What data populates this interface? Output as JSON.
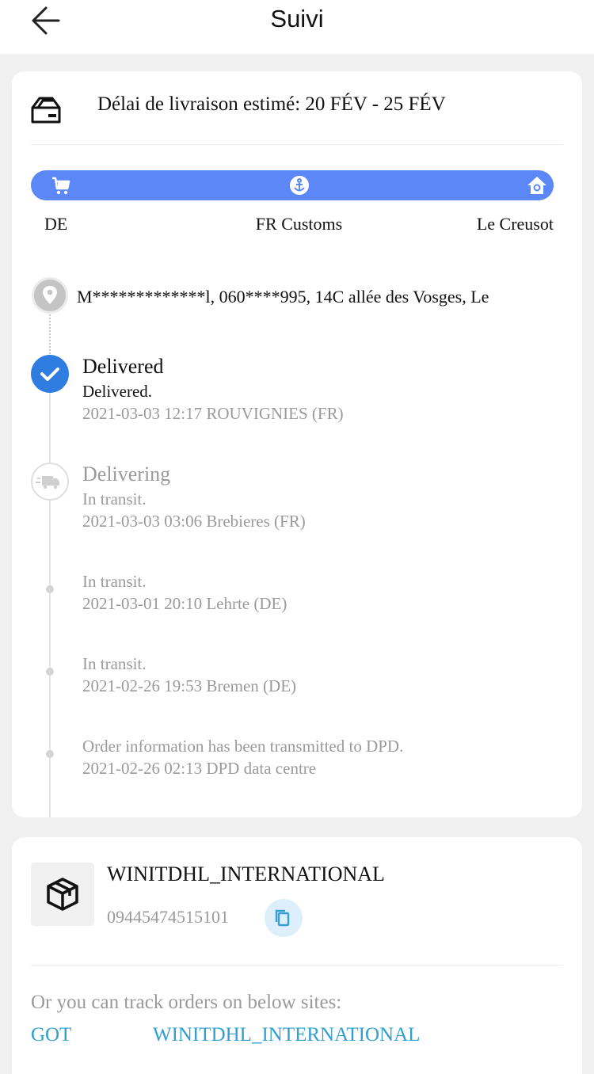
{
  "header": {
    "title": "Suivi"
  },
  "estimate": {
    "text": "Délai de livraison estimé: 20 FÉV - 25 FÉV"
  },
  "route": {
    "color": "#5b87f7",
    "stops": [
      {
        "label": "DE",
        "icon": "cart-icon"
      },
      {
        "label": "FR Customs",
        "icon": "anchor-icon"
      },
      {
        "label": "Le Creusot",
        "icon": "home-icon"
      }
    ]
  },
  "address": {
    "text": "M*************l,  060****995,  14C allée des Vosges,  Le"
  },
  "events": [
    {
      "title": "Delivered",
      "detail": "Delivered.",
      "time_place": "2021-03-03 12:17 ROUVIGNIES (FR)"
    },
    {
      "title": "Delivering",
      "detail": "In transit.",
      "time_place": "2021-03-03 03:06 Brebieres (FR)"
    },
    {
      "detail": "In transit.",
      "time_place": "2021-03-01 20:10 Lehrte (DE)"
    },
    {
      "detail": "In transit.",
      "time_place": "2021-02-26 19:53 Bremen (DE)"
    },
    {
      "detail": "Order information has been transmitted to DPD.",
      "time_place": "2021-02-26 02:13 DPD data centre"
    }
  ],
  "carrier": {
    "name": "WINITDHL_INTERNATIONAL",
    "tracking_number": "09445474515101"
  },
  "track_sites": {
    "note": "Or you can track orders on below sites:",
    "links": [
      "GOT",
      "WINITDHL_INTERNATIONAL"
    ],
    "link_color": "#2f9fd0"
  }
}
